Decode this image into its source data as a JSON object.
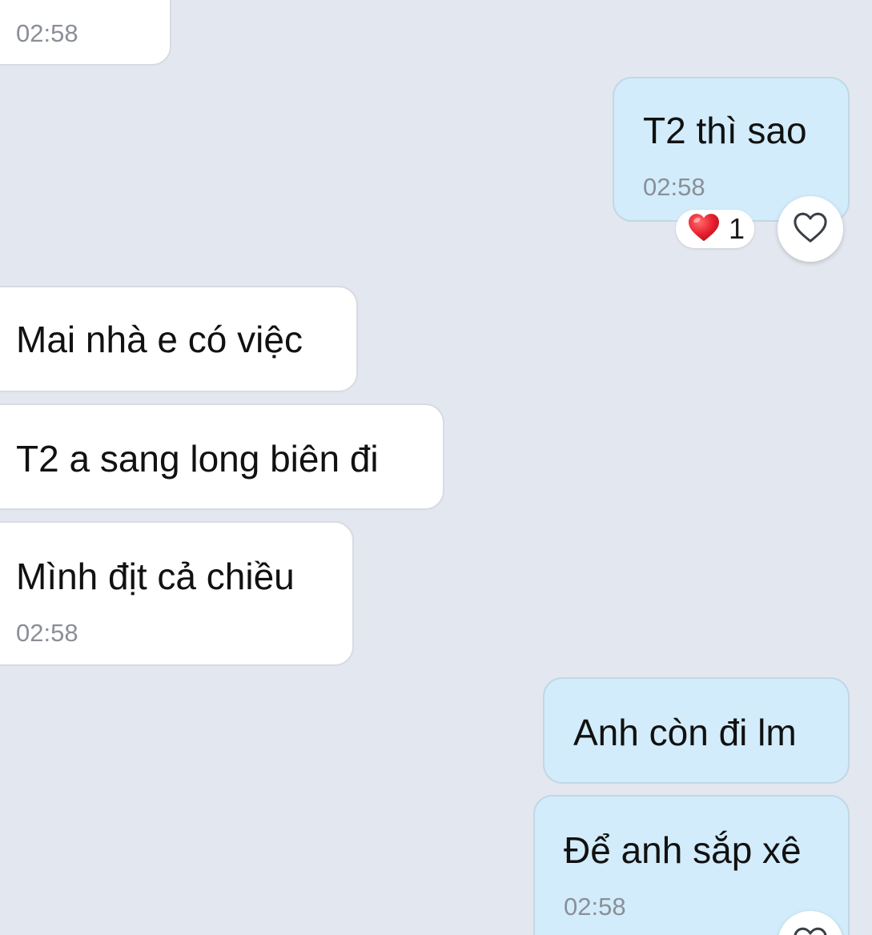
{
  "messages": [
    {
      "direction": "incoming",
      "text": "",
      "time": "02:58"
    },
    {
      "direction": "outgoing",
      "text": "T2 thì sao",
      "time": "02:58",
      "reaction": {
        "emoji": "heart",
        "count": "1"
      }
    },
    {
      "direction": "incoming",
      "text": "Mai nhà e có việc",
      "time": ""
    },
    {
      "direction": "incoming",
      "text": "T2 a sang long biên đi",
      "time": ""
    },
    {
      "direction": "incoming",
      "text": "Mình địt cả chiều",
      "time": "02:58"
    },
    {
      "direction": "outgoing",
      "text": "Anh còn đi lm",
      "time": ""
    },
    {
      "direction": "outgoing",
      "text": "Để anh sắp xê",
      "time": "02:58"
    }
  ],
  "icons": {
    "reaction_emoji": "red-heart-icon",
    "react_button": "heart-outline-icon"
  },
  "colors": {
    "background": "#e3e7ef",
    "incoming_bubble": "#ffffff",
    "outgoing_bubble": "#d2ecfb",
    "timestamp": "#8a8f97",
    "heart": "#e8202e"
  }
}
